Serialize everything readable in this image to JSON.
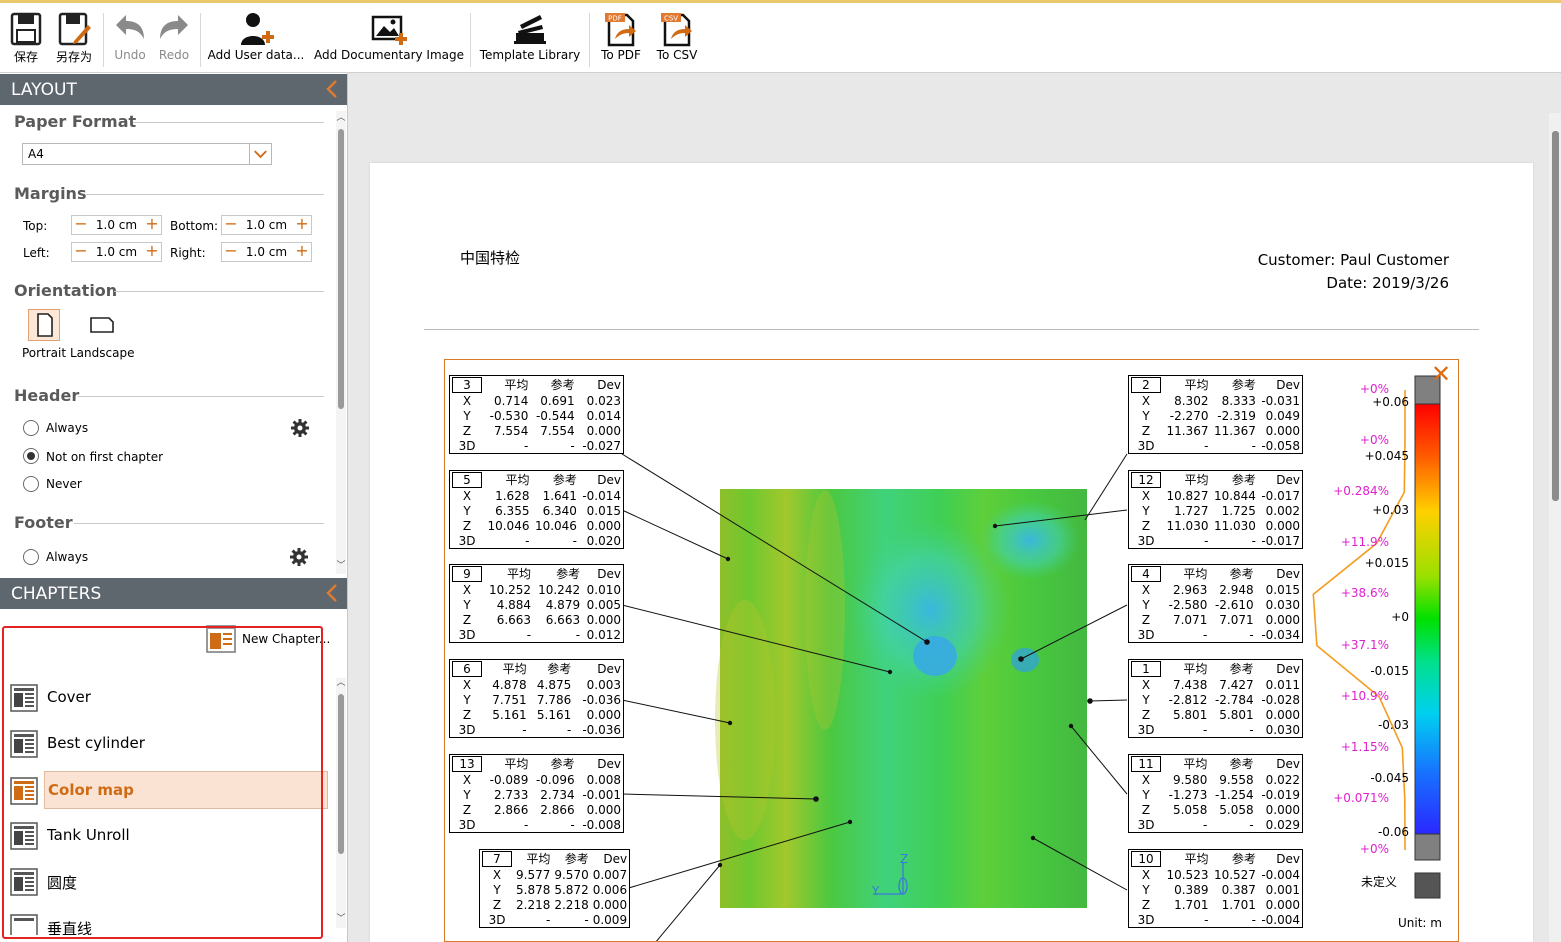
{
  "toolbar": {
    "save": "保存",
    "save_as": "另存为",
    "undo": "Undo",
    "redo": "Redo",
    "add_user_data": "Add User data...",
    "add_doc_image": "Add Documentary Image",
    "template_library": "Template Library",
    "to_pdf": "To PDF",
    "to_csv": "To CSV",
    "pdf_badge": "PDF",
    "csv_badge": "CSV"
  },
  "layout": {
    "title": "LAYOUT",
    "paper_format": {
      "title": "Paper Format",
      "value": "A4"
    },
    "margins": {
      "title": "Margins",
      "top_label": "Top:",
      "top_value": "1.0 cm",
      "bottom_label": "Bottom:",
      "bottom_value": "1.0 cm",
      "left_label": "Left:",
      "left_value": "1.0 cm",
      "right_label": "Right:",
      "right_value": "1.0 cm"
    },
    "orientation": {
      "title": "Orientation",
      "portrait": "Portrait",
      "landscape": "Landscape",
      "selected": "Portrait"
    },
    "header": {
      "title": "Header",
      "options": [
        "Always",
        "Not on first chapter",
        "Never"
      ],
      "selected": "Not on first chapter"
    },
    "footer": {
      "title": "Footer",
      "options": [
        "Always"
      ]
    }
  },
  "chapters": {
    "title": "CHAPTERS",
    "new_chapter": "New Chapter...",
    "items": [
      "Cover",
      "Best cylinder",
      "Color map",
      "Tank Unroll",
      "圆度",
      "垂直线"
    ],
    "selected": "Color map"
  },
  "report": {
    "company": "中国特检",
    "customer_label": "Customer:",
    "customer_value": "Paul Customer",
    "date_label": "Date:",
    "date_value": "2019/3/26",
    "col_headers": [
      "平均",
      "参考",
      "Dev"
    ],
    "axes": [
      "X",
      "Y",
      "Z",
      "3D"
    ],
    "points_left": [
      {
        "id": "3",
        "rows": [
          [
            "0.714",
            "0.691",
            "0.023"
          ],
          [
            "-0.530",
            "-0.544",
            "0.014"
          ],
          [
            "7.554",
            "7.554",
            "0.000"
          ],
          [
            "-",
            "-",
            "-0.027"
          ]
        ]
      },
      {
        "id": "5",
        "rows": [
          [
            "1.628",
            "1.641",
            "-0.014"
          ],
          [
            "6.355",
            "6.340",
            "0.015"
          ],
          [
            "10.046",
            "10.046",
            "0.000"
          ],
          [
            "-",
            "-",
            "0.020"
          ]
        ]
      },
      {
        "id": "9",
        "rows": [
          [
            "10.252",
            "10.242",
            "0.010"
          ],
          [
            "4.884",
            "4.879",
            "0.005"
          ],
          [
            "6.663",
            "6.663",
            "0.000"
          ],
          [
            "-",
            "-",
            "0.012"
          ]
        ]
      },
      {
        "id": "6",
        "rows": [
          [
            "4.878",
            "4.875",
            "0.003"
          ],
          [
            "7.751",
            "7.786",
            "-0.036"
          ],
          [
            "5.161",
            "5.161",
            "0.000"
          ],
          [
            "-",
            "-",
            "-0.036"
          ]
        ]
      },
      {
        "id": "13",
        "rows": [
          [
            "-0.089",
            "-0.096",
            "0.008"
          ],
          [
            "2.733",
            "2.734",
            "-0.001"
          ],
          [
            "2.866",
            "2.866",
            "0.000"
          ],
          [
            "-",
            "-",
            "-0.008"
          ]
        ]
      },
      {
        "id": "7",
        "rows": [
          [
            "9.577",
            "9.570",
            "0.007"
          ],
          [
            "5.878",
            "5.872",
            "0.006"
          ],
          [
            "2.218",
            "2.218",
            "0.000"
          ],
          [
            "-",
            "-",
            "0.009"
          ]
        ]
      }
    ],
    "points_right": [
      {
        "id": "2",
        "rows": [
          [
            "8.302",
            "8.333",
            "-0.031"
          ],
          [
            "-2.270",
            "-2.319",
            "0.049"
          ],
          [
            "11.367",
            "11.367",
            "0.000"
          ],
          [
            "-",
            "-",
            "-0.058"
          ]
        ]
      },
      {
        "id": "12",
        "rows": [
          [
            "10.827",
            "10.844",
            "-0.017"
          ],
          [
            "1.727",
            "1.725",
            "0.002"
          ],
          [
            "11.030",
            "11.030",
            "0.000"
          ],
          [
            "-",
            "-",
            "-0.017"
          ]
        ]
      },
      {
        "id": "4",
        "rows": [
          [
            "2.963",
            "2.948",
            "0.015"
          ],
          [
            "-2.580",
            "-2.610",
            "0.030"
          ],
          [
            "7.071",
            "7.071",
            "0.000"
          ],
          [
            "-",
            "-",
            "-0.034"
          ]
        ]
      },
      {
        "id": "1",
        "rows": [
          [
            "7.438",
            "7.427",
            "0.011"
          ],
          [
            "-2.812",
            "-2.784",
            "-0.028"
          ],
          [
            "5.801",
            "5.801",
            "0.000"
          ],
          [
            "-",
            "-",
            "0.030"
          ]
        ]
      },
      {
        "id": "11",
        "rows": [
          [
            "9.580",
            "9.558",
            "0.022"
          ],
          [
            "-1.273",
            "-1.254",
            "-0.019"
          ],
          [
            "5.058",
            "5.058",
            "0.000"
          ],
          [
            "-",
            "-",
            "0.029"
          ]
        ]
      },
      {
        "id": "10",
        "rows": [
          [
            "10.523",
            "10.527",
            "-0.004"
          ],
          [
            "0.389",
            "0.387",
            "0.001"
          ],
          [
            "1.701",
            "1.701",
            "0.000"
          ],
          [
            "-",
            "-",
            "-0.004"
          ]
        ]
      }
    ],
    "legend": {
      "ticks": [
        "+0.06",
        "+0.045",
        "+0.03",
        "+0.015",
        "+0",
        "-0.015",
        "-0.03",
        "-0.045",
        "-0.06"
      ],
      "percents": [
        "+0%",
        "+0%",
        "+0.284%",
        "+11.9%",
        "+38.6%",
        "+37.1%",
        "+10.9%",
        "+1.15%",
        "+0.071%",
        "+0%"
      ],
      "undefined_label": "未定义",
      "unit_label": "Unit: m"
    },
    "axis_gizmo": {
      "z": "Z",
      "y": "Y"
    }
  },
  "colors": {
    "accent": "#d06b15",
    "header_bar": "#5e666e",
    "highlight": "#e52222",
    "percent_text": "#e020d0",
    "histogram": "#f39c1e"
  }
}
